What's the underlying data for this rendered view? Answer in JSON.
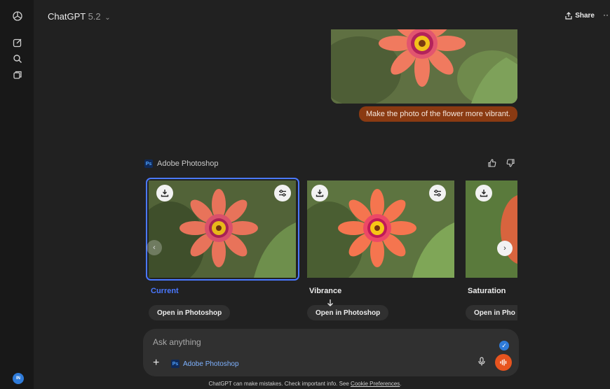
{
  "sidebar": {
    "icons": [
      "openai-logo-icon",
      "new-chat-icon",
      "search-icon",
      "library-icon"
    ],
    "avatar_initials": "IN"
  },
  "header": {
    "model_name": "ChatGPT",
    "model_version": "5.2",
    "share_label": "Share",
    "more_label": "··"
  },
  "conversation": {
    "user_message": "Make the photo of the flower more vibrant.",
    "tool_name": "Adobe Photoshop",
    "cards": [
      {
        "label": "Current",
        "open_label": "Open in Photoshop",
        "selected": true
      },
      {
        "label": "Vibrance",
        "open_label": "Open in Photoshop",
        "selected": false
      },
      {
        "label": "Saturation",
        "open_label": "Open in Pho",
        "selected": false
      }
    ]
  },
  "composer": {
    "placeholder": "Ask anything",
    "tool_chip": "Adobe Photoshop",
    "ps_badge": "Ps"
  },
  "footer": {
    "disclaimer": "ChatGPT can make mistakes. Check important info. See ",
    "link": "Cookie Preferences",
    "end": "."
  },
  "colors": {
    "background": "#212121",
    "accent_blue": "#4a78ff",
    "user_bubble": "#8a3a12",
    "voice_button": "#e7541f"
  }
}
